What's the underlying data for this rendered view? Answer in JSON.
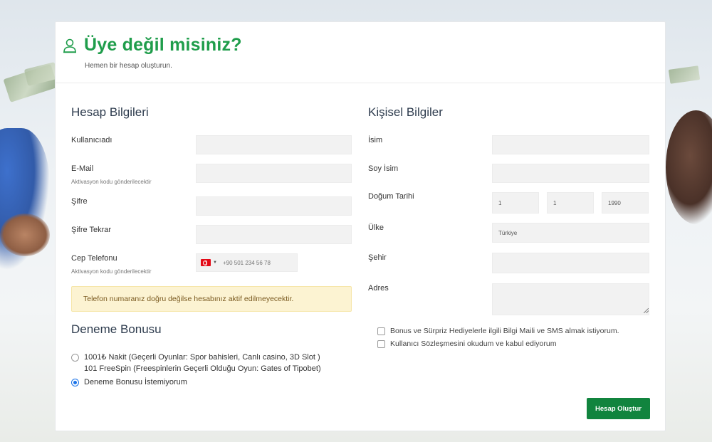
{
  "header": {
    "title": "Üye değil misiniz?",
    "subtitle": "Hemen bir hesap oluşturun.",
    "icon": "user-icon",
    "accent_color": "#1f9d4b"
  },
  "account": {
    "section_title": "Hesap Bilgileri",
    "username_label": "Kullanıcıadı",
    "email_label": "E-Mail",
    "email_hint": "Aktivasyon kodu gönderilecektir",
    "password_label": "Şifre",
    "password_repeat_label": "Şifre Tekrar",
    "phone_label": "Cep Telefonu",
    "phone_hint": "Aktivasyon kodu gönderilecektir",
    "phone_placeholder": "+90 501 234 56 78",
    "phone_country_icon": "turkey-flag-icon",
    "warning_text": "Telefon numaranız doğru değilse hesabınız aktif edilmeyecektir."
  },
  "bonus": {
    "section_title": "Deneme Bonusu",
    "options": [
      {
        "line1": "1001₺ Nakit (Geçerli Oyunlar: Spor bahisleri, Canlı casino, 3D Slot )",
        "line2": "101 FreeSpin (Freespinlerin Geçerli Olduğu Oyun: Gates of Tipobet)",
        "checked": false
      },
      {
        "line1": "Deneme Bonusu İstemiyorum",
        "checked": true
      }
    ]
  },
  "personal": {
    "section_title": "Kişisel Bilgiler",
    "first_name_label": "İsim",
    "last_name_label": "Soy İsim",
    "birthdate_label": "Doğum Tarihi",
    "birth_day": "1",
    "birth_month": "1",
    "birth_year": "1990",
    "country_label": "Ülke",
    "country_value": "Türkiye",
    "city_label": "Şehir",
    "address_label": "Adres"
  },
  "agreements": {
    "sms_mail": "Bonus ve Sürpriz Hediyelerle ilgili Bilgi Maili ve SMS almak istiyorum.",
    "terms": "Kullanıcı Sözleşmesini okudum ve kabul ediyorum"
  },
  "submit_label": "Hesap Oluştur",
  "colors": {
    "button": "#11843e",
    "warning_bg": "#fcf3d2"
  }
}
